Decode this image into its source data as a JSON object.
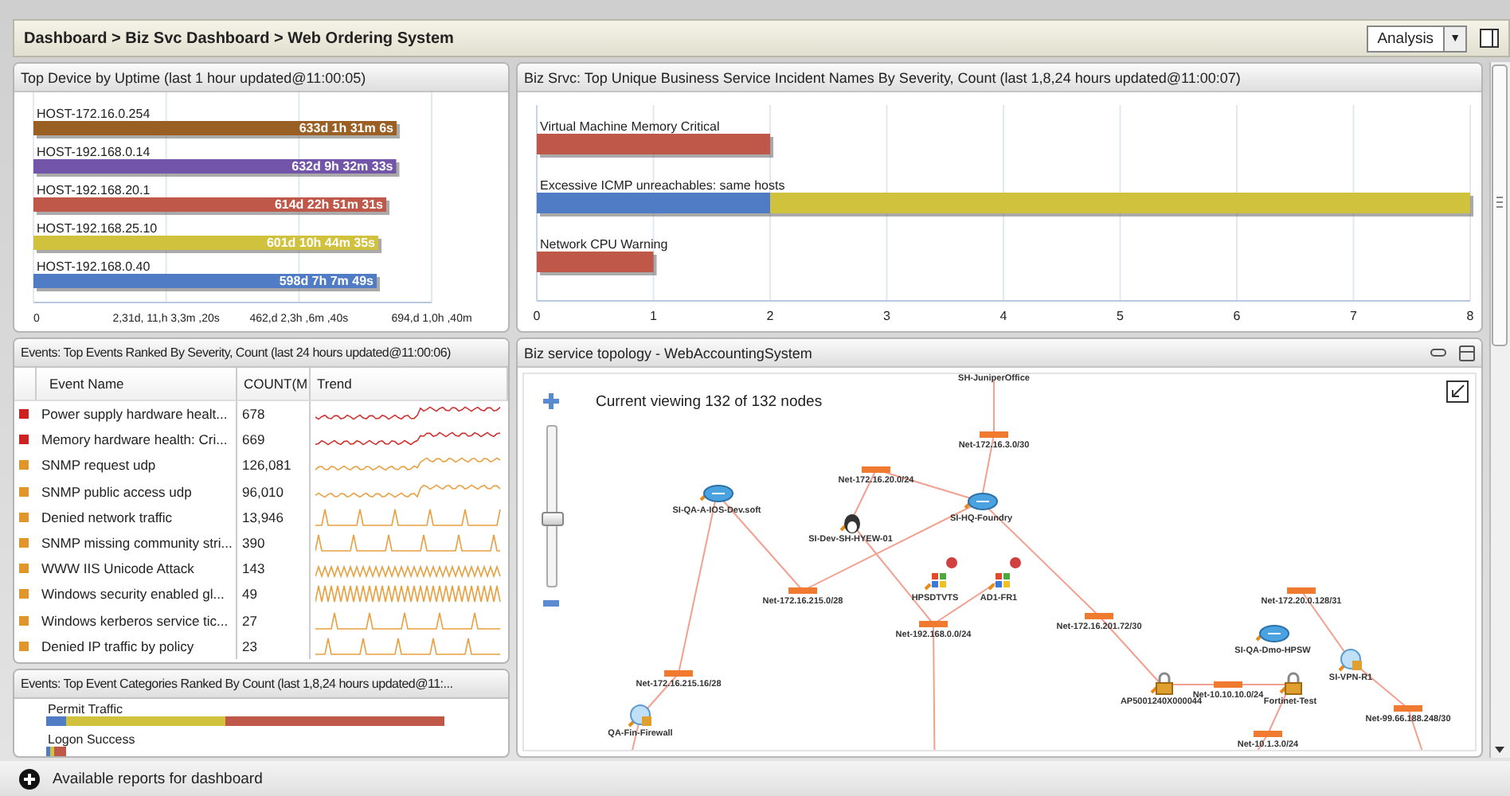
{
  "breadcrumb": "Dashboard > Biz Svc Dashboard > Web Ordering System",
  "view_select": {
    "value": "Analysis",
    "arrow": "▼"
  },
  "uptime_panel": {
    "title": "Top Device by Uptime (last 1 hour updated@11:00:05)",
    "hosts": [
      {
        "name": "HOST-172.16.0.254",
        "uptime": "633d 1h 31m 6s",
        "color": "#9a5f22"
      },
      {
        "name": "HOST-192.168.0.14",
        "uptime": "632d 9h 32m 33s",
        "color": "#7254a8"
      },
      {
        "name": "HOST-192.168.20.1",
        "uptime": "614d 22h 51m 31s",
        "color": "#c0584a"
      },
      {
        "name": "HOST-192.168.25.10",
        "uptime": "601d 10h 44m 35s",
        "color": "#d1c23e"
      },
      {
        "name": "HOST-192.168.0.40",
        "uptime": "598d 7h 7m 49s",
        "color": "#4f7cc4"
      }
    ],
    "axis_labels": [
      "0",
      "2,31d, 11,h 3,3m ,20s",
      "462,d 2,3h ,6m ,40s",
      "694,d 1,0h ,40m"
    ]
  },
  "incident_panel": {
    "title": "Biz Srvc: Top Unique Business Service Incident Names By Severity, Count (last 1,8,24 hours updated@11:00:07)",
    "chart_data": {
      "type": "bar",
      "orientation": "horizontal",
      "stacked": true,
      "grid": true,
      "categories": [
        "Virtual Machine Memory Critical",
        "Excessive ICMP unreachables: same hosts",
        "Network CPU Warning"
      ],
      "series": [
        {
          "color": "#c0584a",
          "values": [
            2,
            null,
            1
          ]
        },
        {
          "color": "#4f7cc4",
          "values": [
            null,
            2,
            null
          ]
        },
        {
          "color": "#d1c23e",
          "values": [
            null,
            6,
            null
          ]
        }
      ],
      "xlim": [
        0,
        8
      ],
      "xticks": [
        0,
        1,
        2,
        3,
        4,
        5,
        6,
        7,
        8
      ]
    }
  },
  "events_panel": {
    "title": "Events: Top Events Ranked By Severity, Count (last 24 hours updated@11:00:06)",
    "columns": [
      "Event Name",
      "COUNT(M",
      "Trend"
    ],
    "rows": [
      {
        "name": "Power supply hardware healt...",
        "count": "678",
        "color": "#cc2222"
      },
      {
        "name": "Memory hardware health: Cri...",
        "count": "669",
        "color": "#cc2222"
      },
      {
        "name": "SNMP request udp",
        "count": "126,081",
        "color": "#e0962a"
      },
      {
        "name": "SNMP public access udp",
        "count": "96,010",
        "color": "#e0962a"
      },
      {
        "name": "Denied network traffic",
        "count": "13,946",
        "color": "#e0962a"
      },
      {
        "name": "SNMP missing community stri...",
        "count": "390",
        "color": "#e0962a"
      },
      {
        "name": "WWW IIS Unicode Attack",
        "count": "143",
        "color": "#e0962a"
      },
      {
        "name": "Windows security enabled  gl...",
        "count": "49",
        "color": "#e0962a"
      },
      {
        "name": "Windows kerberos service tic...",
        "count": "27",
        "color": "#e0962a"
      },
      {
        "name": "Denied IP traffic by policy",
        "count": "23",
        "color": "#e0962a"
      }
    ]
  },
  "categories_panel": {
    "title": "Events: Top Event Categories Ranked By Count (last 1,8,24 hours updated@11:...",
    "labels": [
      "Permit Traffic",
      "Logon Success"
    ]
  },
  "topology_panel": {
    "title": "Biz service topology - WebAccountingSystem",
    "status": "Current viewing 132 of 132 nodes",
    "zoom": {
      "level": 0.42
    },
    "nodes": [
      {
        "label": "SH-JuniperOffice",
        "kind": "offscreen",
        "alert": false
      },
      {
        "label": "Net-172.16.3.0/30",
        "kind": "network",
        "alert": false
      },
      {
        "label": "Net-172.16.20.0/24",
        "kind": "network",
        "alert": false
      },
      {
        "label": "SI-QA-A-IOS-Dev.soft",
        "kind": "router",
        "alert": false
      },
      {
        "label": "SI-HQ-Foundry",
        "kind": "router",
        "alert": false
      },
      {
        "label": "SI-Dev-SH-HYEW-01",
        "kind": "linux",
        "alert": false
      },
      {
        "label": "HPSDTVTS",
        "kind": "windows",
        "alert": true
      },
      {
        "label": "AD1-FR1",
        "kind": "windows",
        "alert": true
      },
      {
        "label": "Net-172.16.215.0/28",
        "kind": "network",
        "alert": false
      },
      {
        "label": "Net-172.20.0.128/31",
        "kind": "network",
        "alert": false
      },
      {
        "label": "Net-172.16.201.72/30",
        "kind": "network",
        "alert": false
      },
      {
        "label": "Net-192.168.0.0/24",
        "kind": "network",
        "alert": false
      },
      {
        "label": "SI-QA-Dmo-HPSW",
        "kind": "router",
        "alert": false
      },
      {
        "label": "SI-VPN-R1",
        "kind": "vpn",
        "alert": false
      },
      {
        "label": "Net-172.16.215.16/28",
        "kind": "network",
        "alert": false
      },
      {
        "label": "AP5001240X000044",
        "kind": "lock",
        "alert": false
      },
      {
        "label": "Net-10.10.10.0/24",
        "kind": "network",
        "alert": false
      },
      {
        "label": "Fortinet-Test",
        "kind": "lock",
        "alert": false
      },
      {
        "label": "Net-99.66.188.248/30",
        "kind": "network",
        "alert": false
      },
      {
        "label": "QA-Fin-Firewall",
        "kind": "firewall",
        "alert": false
      },
      {
        "label": "Net-10.1.3.0/24",
        "kind": "network",
        "alert": false
      }
    ]
  },
  "footer": {
    "label": "Available reports for dashboard"
  }
}
